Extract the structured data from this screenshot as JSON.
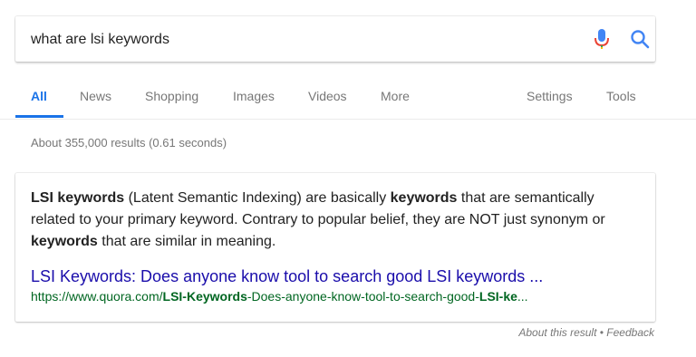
{
  "search": {
    "query": "what are lsi keywords",
    "mic_icon": "microphone-icon",
    "search_icon": "magnifier-icon"
  },
  "tabs": {
    "all": "All",
    "news": "News",
    "shopping": "Shopping",
    "images": "Images",
    "videos": "Videos",
    "more": "More",
    "settings": "Settings",
    "tools": "Tools",
    "active_color": "#1a73e8"
  },
  "stats": "About 355,000 results (0.61 seconds)",
  "featured_snippet": {
    "segments": [
      {
        "text": "LSI keywords",
        "bold": true
      },
      {
        "text": " (Latent Semantic Indexing) are basically ",
        "bold": false
      },
      {
        "text": "keywords",
        "bold": true
      },
      {
        "text": " that are semantically related to your primary keyword. Contrary to popular belief, they are NOT just synonym or ",
        "bold": false
      },
      {
        "text": "keywords",
        "bold": true
      },
      {
        "text": " that are similar in meaning.",
        "bold": false
      }
    ],
    "title": "LSI Keywords: Does anyone know tool to search good LSI keywords ...",
    "url_segments": [
      {
        "text": "https://www.quora.com/",
        "bold": false
      },
      {
        "text": "LSI-Keywords",
        "bold": true
      },
      {
        "text": "-Does-anyone-know-tool-to-search-good-",
        "bold": false
      },
      {
        "text": "LSI-ke",
        "bold": true
      },
      {
        "text": "...",
        "bold": false
      }
    ],
    "title_color": "#1a0dab",
    "url_color": "#006621"
  },
  "footer": {
    "about": "About this result",
    "separator": " • ",
    "feedback": "Feedback"
  }
}
